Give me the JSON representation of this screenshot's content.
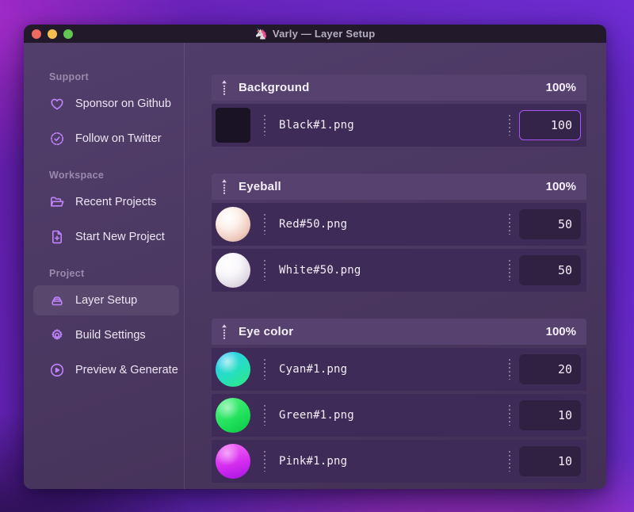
{
  "window": {
    "app_icon": "🦄",
    "title": "Varly — Layer Setup",
    "controls": [
      "close",
      "minimize",
      "zoom"
    ]
  },
  "colors": {
    "accent": "#a855f7",
    "icon": "#c084fc",
    "titlebar": "#221a2b",
    "group_header": "#57416f",
    "row": "#3e2b57"
  },
  "sidebar": {
    "sections": [
      {
        "label": "Support",
        "items": [
          {
            "icon": "heart-icon",
            "label": "Sponsor on Github",
            "active": false
          },
          {
            "icon": "verified-icon",
            "label": "Follow on Twitter",
            "active": false
          }
        ]
      },
      {
        "label": "Workspace",
        "items": [
          {
            "icon": "folder-icon",
            "label": "Recent Projects",
            "active": false
          },
          {
            "icon": "file-plus-icon",
            "label": "Start New Project",
            "active": false
          }
        ]
      },
      {
        "label": "Project",
        "items": [
          {
            "icon": "layers-icon",
            "label": "Layer Setup",
            "active": true
          },
          {
            "icon": "gear-icon",
            "label": "Build Settings",
            "active": false
          },
          {
            "icon": "play-circle-icon",
            "label": "Preview & Generate",
            "active": false
          }
        ]
      }
    ]
  },
  "main": {
    "groups": [
      {
        "name": "Background",
        "opacity": "100%",
        "layers": [
          {
            "thumb": "black-square",
            "file": "Black#1.png",
            "weight": "100",
            "focused": true
          }
        ]
      },
      {
        "name": "Eyeball",
        "opacity": "100%",
        "layers": [
          {
            "thumb": "red-sphere",
            "file": "Red#50.png",
            "weight": "50",
            "focused": false
          },
          {
            "thumb": "white-sphere",
            "file": "White#50.png",
            "weight": "50",
            "focused": false
          }
        ]
      },
      {
        "name": "Eye color",
        "opacity": "100%",
        "layers": [
          {
            "thumb": "cyan-sphere",
            "file": "Cyan#1.png",
            "weight": "20",
            "focused": false
          },
          {
            "thumb": "green-sphere",
            "file": "Green#1.png",
            "weight": "10",
            "focused": false
          },
          {
            "thumb": "pink-sphere",
            "file": "Pink#1.png",
            "weight": "10",
            "focused": false
          }
        ]
      }
    ]
  }
}
